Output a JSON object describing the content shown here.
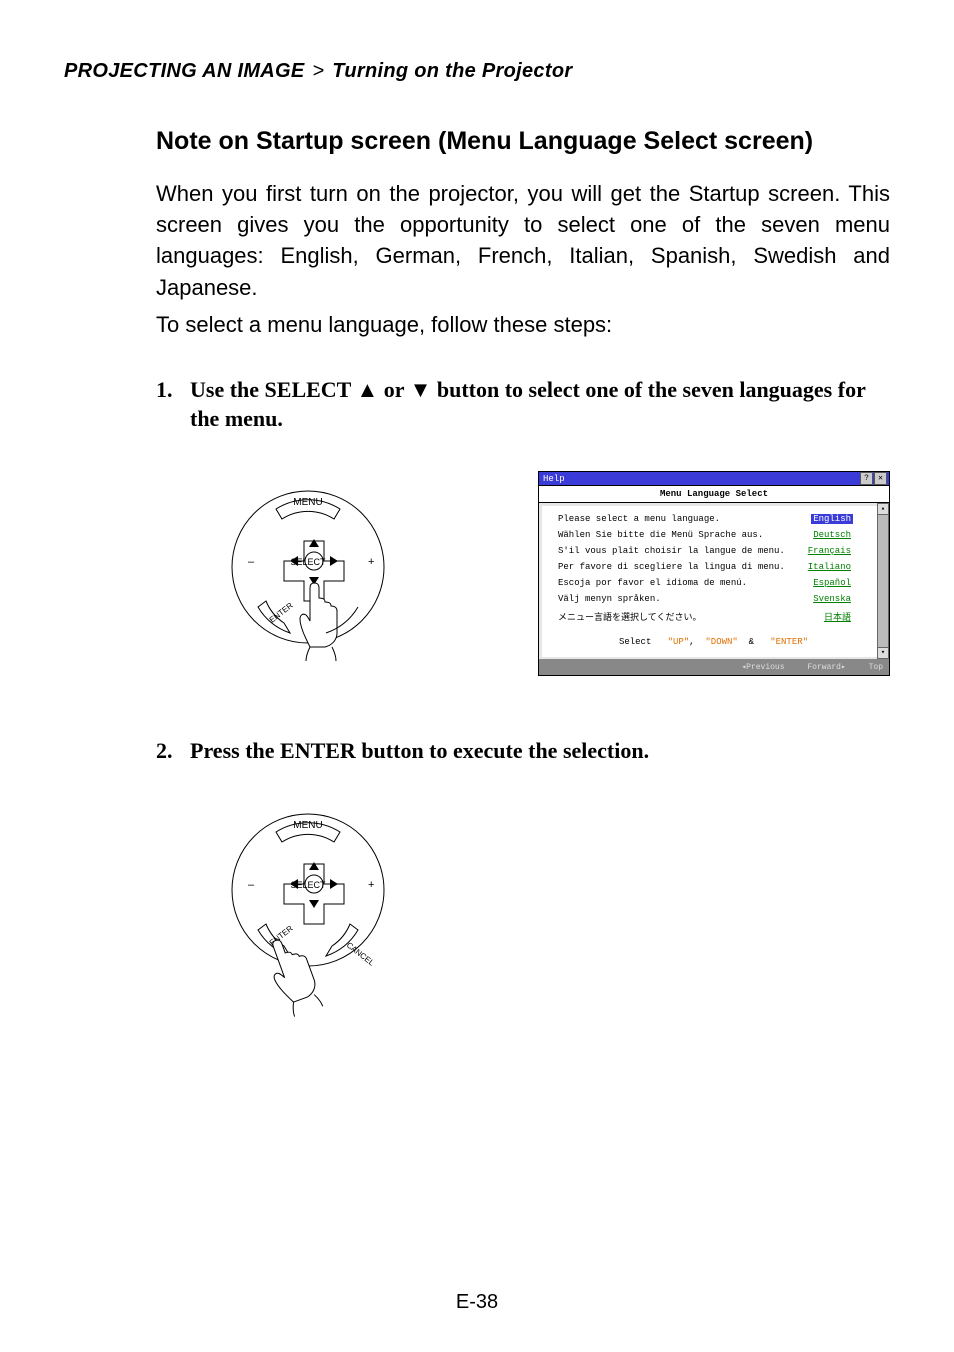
{
  "breadcrumb": {
    "section": "PROJECTING AN IMAGE",
    "separator": ">",
    "sub": "Turning on the Projector"
  },
  "heading": "Note on Startup screen (Menu Language Select screen)",
  "intro": "When you first turn on the projector, you will get the Startup screen. This screen gives you the opportunity to select one of the seven menu languages: English, German, French, Italian, Spanish, Swedish and Japanese.",
  "steps_lead": "To select a menu language, follow these steps:",
  "step1": {
    "num": "1.",
    "text": "Use the SELECT ▲ or ▼ button to select one of the seven languages for the menu."
  },
  "step2": {
    "num": "2.",
    "text": "Press the ENTER button to execute the selection."
  },
  "controller_labels": {
    "menu": "MENU",
    "select": "SELECT",
    "enter": "ENTER",
    "cancel": "CANCEL",
    "minus": "–",
    "plus": "+"
  },
  "lang_screen": {
    "titlebar": "Help",
    "subtitle": "Menu Language Select",
    "rows": [
      {
        "prompt": "Please select a menu language.",
        "lang": "English",
        "selected": true
      },
      {
        "prompt": "Wählen Sie bitte die Menü Sprache aus.",
        "lang": "Deutsch",
        "selected": false
      },
      {
        "prompt": "S'il vous plaît choisir la langue de menu.",
        "lang": "Français",
        "selected": false
      },
      {
        "prompt": "Per favore di scegliere la lingua di menu.",
        "lang": "Italiano",
        "selected": false
      },
      {
        "prompt": "Escoja por favor el idioma de menú.",
        "lang": "Español",
        "selected": false
      },
      {
        "prompt": "Välj menyn språken.",
        "lang": "Svenska",
        "selected": false
      },
      {
        "prompt": "メニュー言語を選択してください。",
        "lang": "日本語",
        "selected": false
      }
    ],
    "instruction_parts": {
      "p1": "Select",
      "p2": "\"UP\"",
      "p3": ",",
      "p4": "\"DOWN\"",
      "p5": "&",
      "p6": "\"ENTER\""
    },
    "footer": {
      "prev": "◂Previous",
      "fwd": "Forward▸",
      "top": "Top"
    },
    "title_buttons": {
      "help": "?",
      "close": "✕"
    },
    "scroll": {
      "up": "▴",
      "down": "▾"
    }
  },
  "page_number": "E-38"
}
